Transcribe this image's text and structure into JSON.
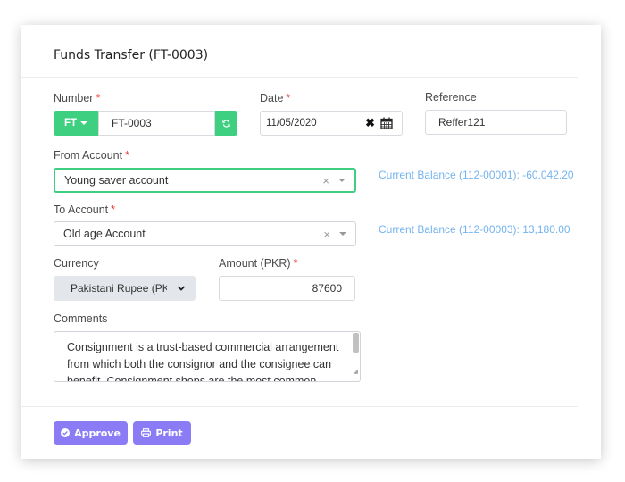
{
  "form": {
    "title": "Funds Transfer (FT-0003)",
    "number": {
      "label": "Number",
      "required_mark": "*",
      "prefix_label": "FT",
      "value": "FT-0003",
      "refresh_icon": "refresh-icon"
    },
    "date": {
      "label": "Date",
      "required_mark": "*",
      "value": "11/05/2020",
      "clear_icon": "✖",
      "calendar_icon": "calendar-icon"
    },
    "reference": {
      "label": "Reference",
      "value": "Reffer121"
    },
    "from_account": {
      "label": "From Account",
      "required_mark": "*",
      "value": "Young saver account",
      "clear_icon": "×",
      "balance": "Current Balance (112-00001): -60,042.20"
    },
    "to_account": {
      "label": "To Account",
      "required_mark": "*",
      "value": "Old age Account",
      "clear_icon": "×",
      "balance": "Current Balance (112-00003): 13,180.00"
    },
    "currency": {
      "label": "Currency",
      "value": "Pakistani Rupee (PKR)"
    },
    "amount": {
      "label": "Amount (PKR)",
      "required_mark": "*",
      "value": "87600"
    },
    "comments": {
      "label": "Comments",
      "value": "Consignment is a trust-based commercial arrangement from which both the consignor and the consignee can benefit. Consignment shops are the most common"
    }
  },
  "actions": {
    "approve_label": "Approve",
    "print_label": "Print"
  },
  "colors": {
    "accent_green": "#3ecf80",
    "button_purple": "#8b7cf6",
    "balance_blue": "#74b4ee",
    "required_red": "#e53935"
  }
}
